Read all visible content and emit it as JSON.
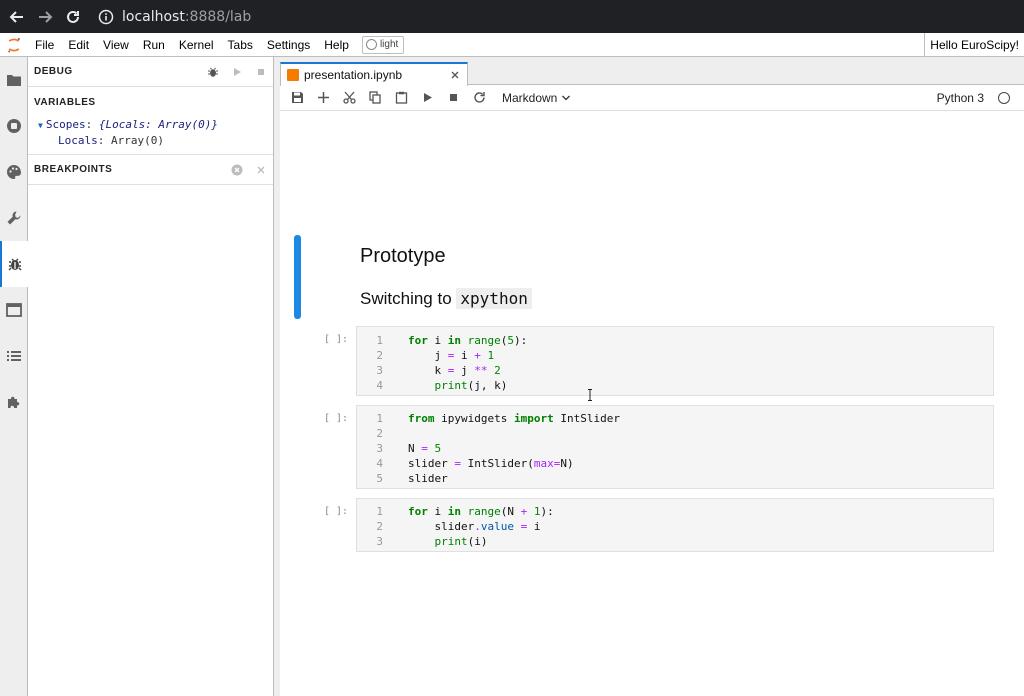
{
  "browser": {
    "url_host": "localhost",
    "url_rest": ":8888/lab"
  },
  "menubar": {
    "items": [
      "File",
      "Edit",
      "View",
      "Run",
      "Kernel",
      "Tabs",
      "Settings",
      "Help"
    ],
    "theme_toggle_label": "light",
    "greeting": "Hello EuroScipy!"
  },
  "debug_panel": {
    "title": "DEBUG",
    "variables_title": "VARIABLES",
    "scopes_key": "Scopes",
    "scopes_value": "{Locals: Array(0)}",
    "locals_key": "Locals",
    "locals_value": "Array(0)",
    "breakpoints_title": "BREAKPOINTS"
  },
  "tab": {
    "title": "presentation.ipynb"
  },
  "toolbar": {
    "cell_type": "Markdown",
    "kernel_name": "Python 3"
  },
  "notebook": {
    "markdown": {
      "heading1": "Prototype",
      "heading2_prefix": "Switching to",
      "heading2_code": "xpython"
    },
    "cells": [
      {
        "prompt": "[ ]:",
        "lines": [
          "for i in range(5):",
          "    j = i + 1",
          "    k = j ** 2",
          "    print(j, k)"
        ]
      },
      {
        "prompt": "[ ]:",
        "lines": [
          "from ipywidgets import IntSlider",
          "",
          "N = 5",
          "slider = IntSlider(max=N)",
          "slider"
        ]
      },
      {
        "prompt": "[ ]:",
        "lines": [
          "for i in range(N + 1):",
          "    slider.value = i",
          "    print(i)"
        ]
      }
    ]
  },
  "colors": {
    "accent": "#1976d2",
    "markdown_collapser": "#1e88e5",
    "notebook_icon": "#f57c00",
    "keyword": "#008000",
    "operator": "#aa22ff"
  }
}
